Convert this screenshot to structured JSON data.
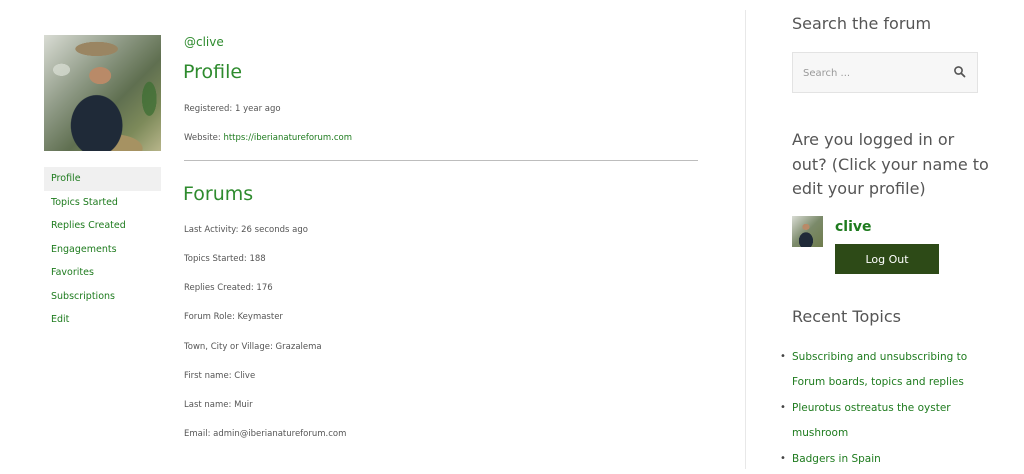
{
  "profile_nav": {
    "items": [
      {
        "label": "Profile"
      },
      {
        "label": "Topics Started"
      },
      {
        "label": "Replies Created"
      },
      {
        "label": "Engagements"
      },
      {
        "label": "Favorites"
      },
      {
        "label": "Subscriptions"
      },
      {
        "label": "Edit"
      }
    ]
  },
  "main": {
    "handle": "@clive",
    "profile_title": "Profile",
    "registered": "Registered: 1 year ago",
    "website_label": "Website: ",
    "website_url": "https://iberianatureforum.com",
    "forums_title": "Forums",
    "last_activity": "Last Activity: 26 seconds ago",
    "topics_started": "Topics Started: 188",
    "replies_created": "Replies Created: 176",
    "forum_role": "Forum Role: Keymaster",
    "town": "Town, City or Village: Grazalema",
    "first_name": "First name: Clive",
    "last_name": "Last name: Muir",
    "email": "Email: admin@iberianatureforum.com"
  },
  "sidebar": {
    "search_title": "Search the forum",
    "search_placeholder": "Search ...",
    "login_title": "Are you logged in or out? (Click your name to edit your profile)",
    "username": "clive",
    "logout_label": "Log Out",
    "recent_title": "Recent Topics",
    "recent_topics": [
      {
        "title": "Subscribing and unsubscribing to Forum boards, topics and replies"
      },
      {
        "title": "Pleurotus ostreatus the oyster mushroom"
      },
      {
        "title": "Badgers in Spain"
      }
    ]
  },
  "icons": [
    "search-icon"
  ],
  "colors": {
    "link": "#1e7b1e",
    "heading_green": "#2e8b2e",
    "button": "#2d4a17"
  }
}
